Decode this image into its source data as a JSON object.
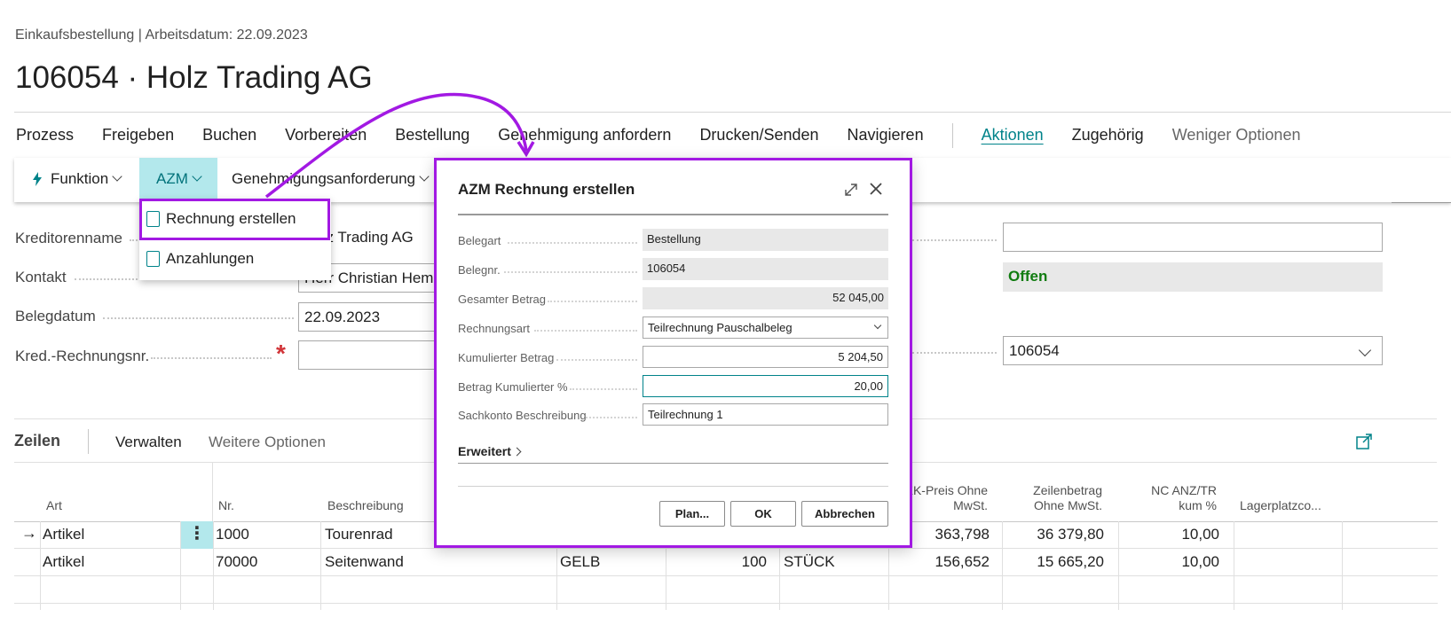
{
  "header": {
    "breadcrumb": "Einkaufsbestellung | Arbeitsdatum: 22.09.2023",
    "title": "106054 · Holz Trading AG"
  },
  "menu": {
    "items": [
      "Prozess",
      "Freigeben",
      "Buchen",
      "Vorbereiten",
      "Bestellung",
      "Genehmigung anfordern",
      "Drucken/Senden",
      "Navigieren"
    ],
    "actions": "Aktionen",
    "related": "Zugehörig",
    "fewer": "Weniger Optionen"
  },
  "actionbar": {
    "funktion": "Funktion",
    "azm": "AZM",
    "approval": "Genehmigungsanforderung"
  },
  "dropdown": {
    "item1": "Rechnung erstellen",
    "item2": "Anzahlungen"
  },
  "form": {
    "kreditorenname_label": "Kreditorenname",
    "kreditorenname_value": "Holz Trading AG",
    "kontakt_label": "Kontakt",
    "kontakt_value": "Herr Christian Hemp",
    "belegdatum_label": "Belegdatum",
    "belegdatum_value": "22.09.2023",
    "kredrechnr_label": "Kred.-Rechnungsnr.",
    "required_mark": "*",
    "status_value": "Offen",
    "right_select_value": "106054"
  },
  "lines": {
    "tab_title": "Zeilen",
    "manage": "Verwalten",
    "more_options": "Weitere Optionen",
    "columns": {
      "art": "Art",
      "nr": "Nr.",
      "beschreibung": "Beschreibung",
      "ek_preis_1": "EK-Preis Ohne",
      "ek_preis_2": "MwSt.",
      "zeilenbetrag_1": "Zeilenbetrag",
      "zeilenbetrag_2": "Ohne MwSt.",
      "nc_1": "NC ANZ/TR",
      "nc_2": "kum %",
      "lagerplatz": "Lagerplatzco..."
    },
    "rows": [
      {
        "art": "Artikel",
        "nr": "1000",
        "beschreibung": "Tourenrad",
        "variante": "",
        "menge": "",
        "einheit": "",
        "ek": "363,798",
        "betrag": "36 379,80",
        "nc": "10,00"
      },
      {
        "art": "Artikel",
        "nr": "70000",
        "beschreibung": "Seitenwand",
        "variante": "GELB",
        "menge": "100",
        "einheit": "STÜCK",
        "ek": "156,652",
        "betrag": "15 665,20",
        "nc": "10,00"
      }
    ]
  },
  "dialog": {
    "title": "AZM Rechnung erstellen",
    "belegart_label": "Belegart",
    "belegart_value": "Bestellung",
    "belegnr_label": "Belegnr.",
    "belegnr_value": "106054",
    "gesamt_label": "Gesamter Betrag",
    "gesamt_value": "52 045,00",
    "rechnungsart_label": "Rechnungsart",
    "rechnungsart_value": "Teilrechnung Pauschalbeleg",
    "kumuliert_label": "Kumulierter Betrag",
    "kumuliert_value": "5 204,50",
    "prozent_label": "Betrag Kumulierter %",
    "prozent_value": "20,00",
    "sachkonto_label": "Sachkonto Beschreibung",
    "sachkonto_value": "Teilrechnung 1",
    "erweitert": "Erweitert",
    "btn_plan": "Plan...",
    "btn_ok": "OK",
    "btn_cancel": "Abbrechen"
  },
  "colors": {
    "accent": "#00838a",
    "highlight": "#a219e3",
    "status_green": "#107c10",
    "required_red": "#d13438"
  }
}
